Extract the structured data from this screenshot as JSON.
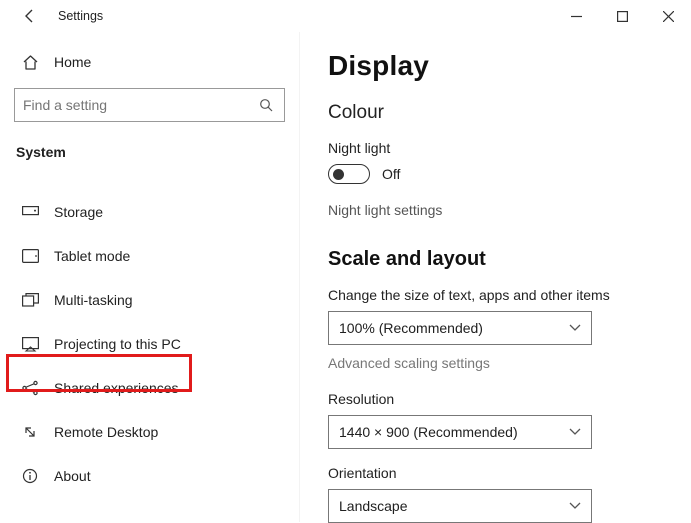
{
  "window": {
    "title": "Settings"
  },
  "sidebar": {
    "home_label": "Home",
    "search_placeholder": "Find a setting",
    "section_label": "System",
    "items": [
      {
        "label": "Storage"
      },
      {
        "label": "Tablet mode"
      },
      {
        "label": "Multi-tasking"
      },
      {
        "label": "Projecting to this PC"
      },
      {
        "label": "Shared experiences"
      },
      {
        "label": "Remote Desktop"
      },
      {
        "label": "About"
      }
    ]
  },
  "content": {
    "page_title": "Display",
    "colour_heading": "Colour",
    "night_light_label": "Night light",
    "night_light_state": "Off",
    "night_light_settings_link": "Night light settings",
    "scale_heading": "Scale and layout",
    "scale_text_label": "Change the size of text, apps and other items",
    "scale_value": "100% (Recommended)",
    "advanced_scaling_link": "Advanced scaling settings",
    "resolution_label": "Resolution",
    "resolution_value": "1440 × 900 (Recommended)",
    "orientation_label": "Orientation",
    "orientation_value": "Landscape"
  }
}
